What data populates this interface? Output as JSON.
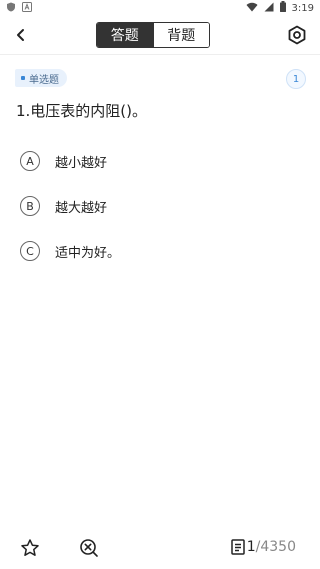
{
  "status_bar": {
    "time": "3:19",
    "left_icons": [
      "shield-icon",
      "notification-a-icon"
    ],
    "right_icons": [
      "wifi-icon",
      "signal-icon",
      "battery-icon"
    ]
  },
  "header": {
    "tabs": [
      {
        "label": "答题",
        "active": true
      },
      {
        "label": "背题",
        "active": false
      }
    ]
  },
  "question": {
    "type_label": "单选题",
    "index": "1",
    "text": "1.电压表的内阻()。",
    "options": [
      {
        "letter": "A",
        "text": "越小越好"
      },
      {
        "letter": "B",
        "text": "越大越好"
      },
      {
        "letter": "C",
        "text": "适中为好。"
      }
    ]
  },
  "bottom_bar": {
    "current": "1",
    "total": "/4350"
  },
  "colors": {
    "accent_blue": "#3a87d6",
    "badge_bg": "#e8f1fc",
    "active_tab_bg": "#333333"
  }
}
